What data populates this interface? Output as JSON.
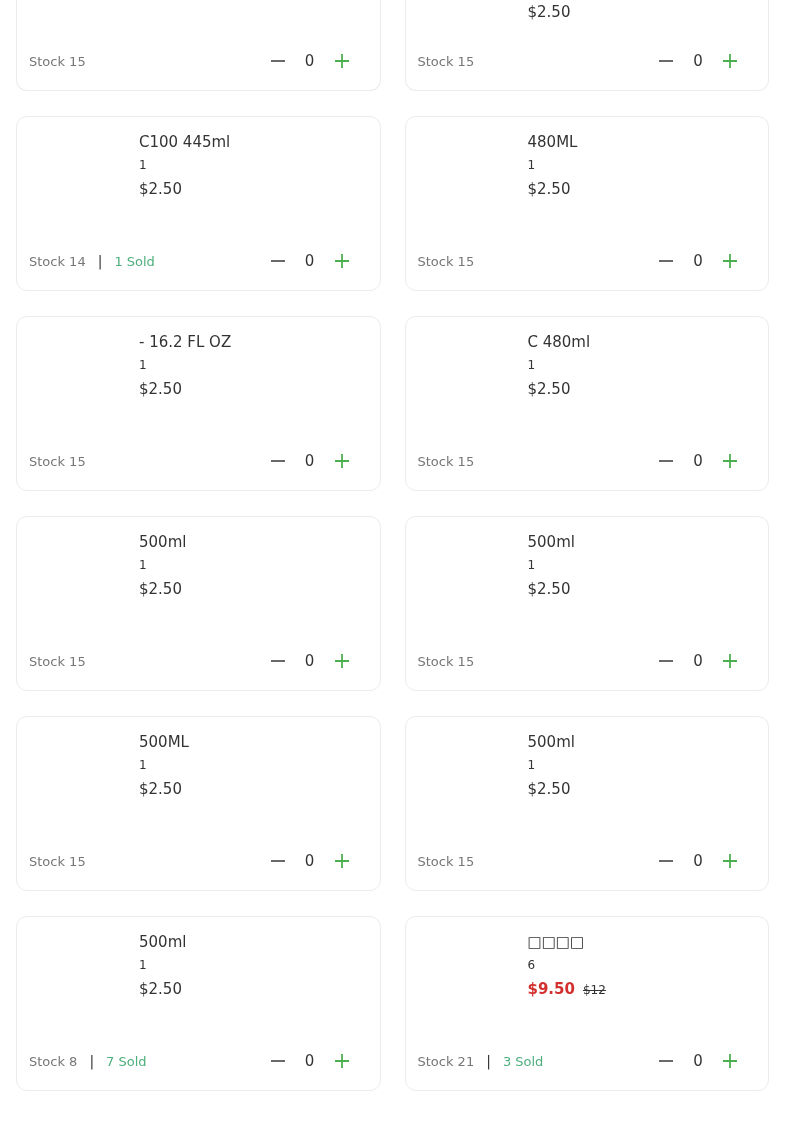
{
  "cut_off_row": {
    "left": {
      "stock": "Stock 15",
      "count": "0"
    },
    "right": {
      "price": "$2.50",
      "stock": "Stock 15",
      "count": "0"
    }
  },
  "products": [
    {
      "name": "C100 445ml",
      "quantity": "1",
      "price": "$2.50",
      "discounted": false,
      "stock": "Stock 14",
      "separator": "|",
      "sold": "1 Sold",
      "count": "0"
    },
    {
      "name": "480ML",
      "quantity": "1",
      "price": "$2.50",
      "discounted": false,
      "stock": "Stock 15",
      "count": "0"
    },
    {
      "name": "- 16.2 FL OZ",
      "quantity": "1",
      "price": "$2.50",
      "discounted": false,
      "stock": "Stock 15",
      "count": "0"
    },
    {
      "name": "C 480ml",
      "quantity": "1",
      "price": "$2.50",
      "discounted": false,
      "stock": "Stock 15",
      "count": "0"
    },
    {
      "name": "500ml",
      "quantity": "1",
      "price": "$2.50",
      "discounted": false,
      "stock": "Stock 15",
      "count": "0"
    },
    {
      "name": "500ml",
      "quantity": "1",
      "price": "$2.50",
      "discounted": false,
      "stock": "Stock 15",
      "count": "0"
    },
    {
      "name": "500ML",
      "quantity": "1",
      "price": "$2.50",
      "discounted": false,
      "stock": "Stock 15",
      "count": "0"
    },
    {
      "name": "500ml",
      "quantity": "1",
      "price": "$2.50",
      "discounted": false,
      "stock": "Stock 15",
      "count": "0"
    },
    {
      "name": "500ml",
      "quantity": "1",
      "price": "$2.50",
      "discounted": false,
      "stock": "Stock 8",
      "separator": "|",
      "sold": "7 Sold",
      "count": "0"
    },
    {
      "name": "□□□□",
      "quantity": "6",
      "price": "$9.50",
      "original_price": "$12",
      "discounted": true,
      "stock": "Stock 21",
      "separator": "|",
      "sold": "3 Sold",
      "count": "0"
    }
  ]
}
